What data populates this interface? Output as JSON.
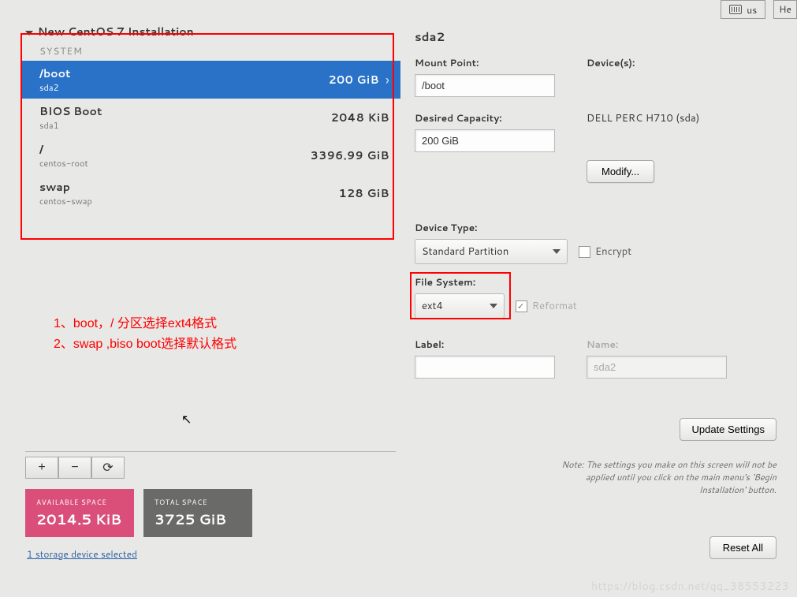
{
  "topbar": {
    "keyboard": "us",
    "help": "He"
  },
  "tree": {
    "title": "New CentOS 7 Installation",
    "system": "SYSTEM"
  },
  "partitions": [
    {
      "mount": "/boot",
      "dev": "sda2",
      "size": "200 GiB",
      "selected": true
    },
    {
      "mount": "BIOS Boot",
      "dev": "sda1",
      "size": "2048 KiB"
    },
    {
      "mount": "/",
      "dev": "centos-root",
      "size": "3396.99 GiB"
    },
    {
      "mount": "swap",
      "dev": "centos-swap",
      "size": "128 GiB"
    }
  ],
  "annotation": {
    "line1": "1、boot，/ 分区选择ext4格式",
    "line2": "2、swap ,biso boot选择默认格式"
  },
  "toolbar": {
    "add": "+",
    "remove": "−",
    "reload": "⟳"
  },
  "space": {
    "avail_label": "AVAILABLE SPACE",
    "avail_value": "2014.5 KiB",
    "total_label": "TOTAL SPACE",
    "total_value": "3725 GiB"
  },
  "storage_link": "1 storage device selected",
  "right": {
    "header": "sda2",
    "mount_label": "Mount Point:",
    "mount_value": "/boot",
    "cap_label": "Desired Capacity:",
    "cap_value": "200 GiB",
    "devices_label": "Device(s):",
    "device_name": "DELL PERC H710 (sda)",
    "modify": "Modify...",
    "devtype_label": "Device Type:",
    "devtype_value": "Standard Partition",
    "encrypt": "Encrypt",
    "fs_label": "File System:",
    "fs_value": "ext4",
    "reformat": "Reformat",
    "label_label": "Label:",
    "label_value": "",
    "name_label": "Name:",
    "name_value": "sda2",
    "update": "Update Settings",
    "note": "Note:  The settings you make on this screen will not be applied until you click on the main menu's 'Begin Installation' button.",
    "reset": "Reset All"
  },
  "watermark": "https://blog.csdn.net/qq_38553223"
}
